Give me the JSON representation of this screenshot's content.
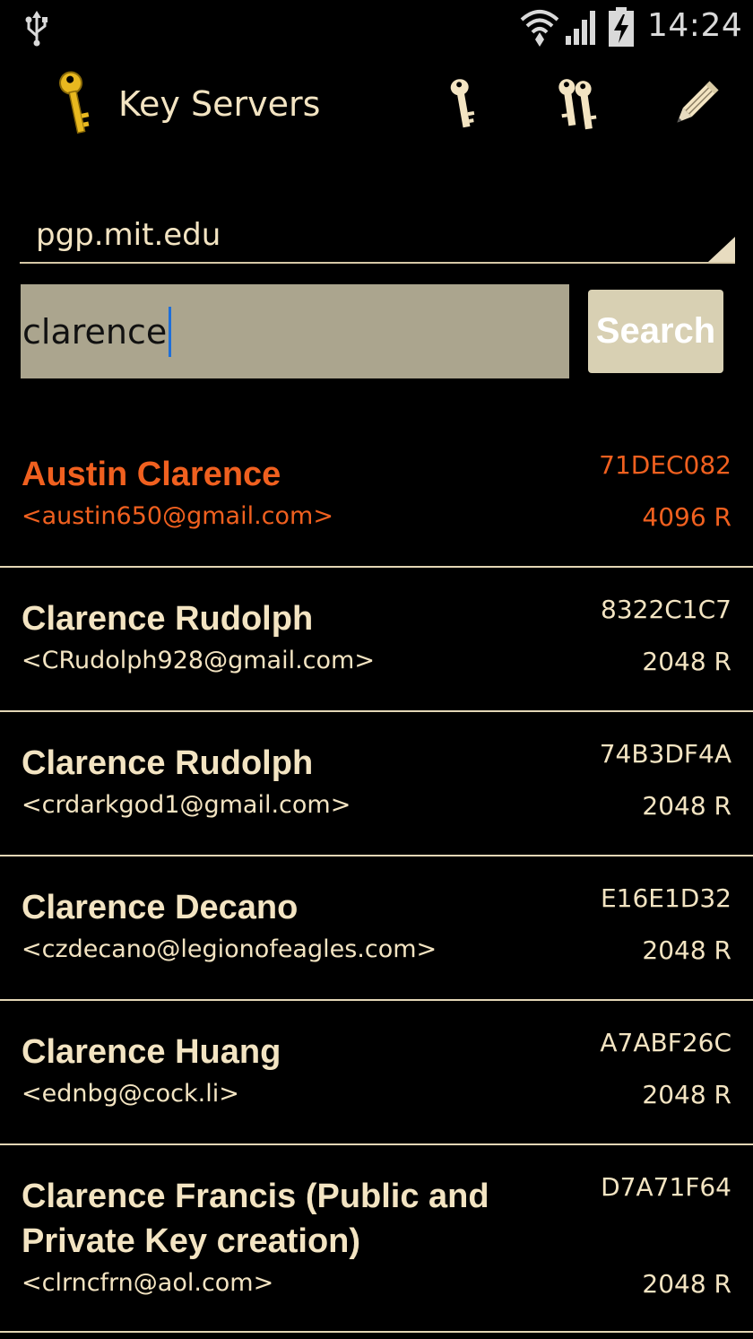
{
  "status_bar": {
    "time": "14:24",
    "icons": [
      "usb-icon",
      "wifi-icon",
      "signal-icon",
      "battery-charging-icon"
    ]
  },
  "action_bar": {
    "title": "Key Servers",
    "app_icon": "gold-key-icon",
    "actions": [
      "key-icon",
      "keys-icon",
      "pencil-icon"
    ]
  },
  "server": {
    "selected": "pgp.mit.edu"
  },
  "search": {
    "value": "clarence",
    "button_label": "Search"
  },
  "colors": {
    "text": "#f3e4c2",
    "highlight": "#f0601f",
    "input_bg": "#aba58e",
    "button_bg": "#d8d0b3",
    "divider": "#e3d6b5",
    "background": "#000000"
  },
  "results": [
    {
      "name": "Austin Clarence",
      "email": "<austin650@gmail.com>",
      "key_id": "71DEC082",
      "size": "4096 R",
      "selected": true
    },
    {
      "name": "Clarence Rudolph",
      "email": "<CRudolph928@gmail.com>",
      "key_id": "8322C1C7",
      "size": "2048 R",
      "selected": false
    },
    {
      "name": "Clarence Rudolph",
      "email": "<crdarkgod1@gmail.com>",
      "key_id": "74B3DF4A",
      "size": "2048 R",
      "selected": false
    },
    {
      "name": "Clarence Decano",
      "email": "<czdecano@legionofeagles.com>",
      "key_id": "E16E1D32",
      "size": "2048 R",
      "selected": false
    },
    {
      "name": "Clarence Huang",
      "email": "<ednbg@cock.li>",
      "key_id": "A7ABF26C",
      "size": "2048 R",
      "selected": false
    },
    {
      "name": "Clarence Francis (Public and Private Key creation)",
      "email": "<clrncfrn@aol.com>",
      "key_id": "D7A71F64",
      "size": "2048 R",
      "selected": false
    }
  ]
}
